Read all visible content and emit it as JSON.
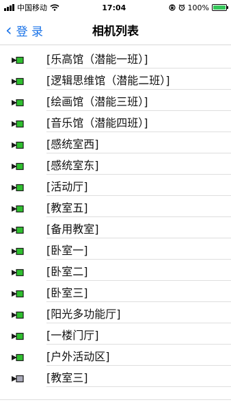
{
  "status_bar": {
    "carrier": "中国移动",
    "time": "17:04",
    "battery_percent": "100%",
    "battery_level": 1.0,
    "signal_bars": 4
  },
  "nav": {
    "back_label": "登 录",
    "title": "相机列表"
  },
  "cameras": [
    {
      "label": "[乐高馆（潜能一班）]",
      "online": true
    },
    {
      "label": "[逻辑思维馆（潜能二班）]",
      "online": true
    },
    {
      "label": "[绘画馆（潜能三班）]",
      "online": true
    },
    {
      "label": "[音乐馆（潜能四班）]",
      "online": true
    },
    {
      "label": "[感统室西]",
      "online": true
    },
    {
      "label": "[感统室东]",
      "online": true
    },
    {
      "label": "[活动厅]",
      "online": true
    },
    {
      "label": "[教室五]",
      "online": true
    },
    {
      "label": "[备用教室]",
      "online": true
    },
    {
      "label": "[卧室一]",
      "online": true
    },
    {
      "label": "[卧室二]",
      "online": true
    },
    {
      "label": "[卧室三]",
      "online": true
    },
    {
      "label": "[阳光多功能厅]",
      "online": true
    },
    {
      "label": "[一楼门厅]",
      "online": true
    },
    {
      "label": "[户外活动区]",
      "online": true
    },
    {
      "label": "[教室三]",
      "online": false
    }
  ],
  "colors": {
    "accent": "#1a73e8",
    "camera_online": "#2fbf2f",
    "camera_offline": "#a9a9b8",
    "camera_dark": "#1a1a1a",
    "battery_fill": "#34c759"
  },
  "icons": {
    "back": "chevron-left-icon",
    "camera": "camera-icon",
    "wifi": "wifi-icon",
    "alarm": "alarm-icon",
    "lock": "rotation-lock-icon",
    "battery": "battery-icon",
    "signal": "signal-icon"
  }
}
